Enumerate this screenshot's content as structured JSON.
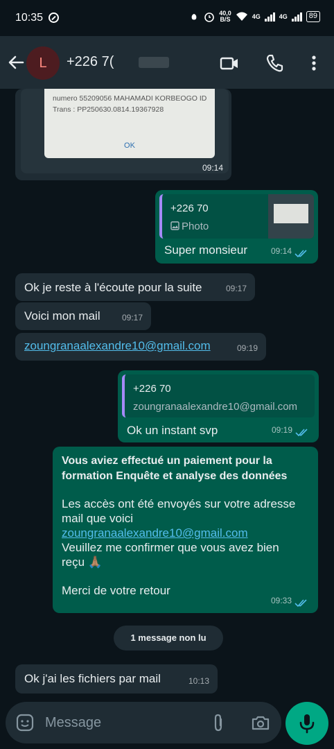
{
  "status": {
    "time": "10:35",
    "net_speed_value": "40,0",
    "net_speed_unit": "B/S",
    "net1": "4G",
    "net2": "4G",
    "battery": "89"
  },
  "header": {
    "avatar_letter": "L",
    "contact": "+226 7("
  },
  "messages": {
    "photo_in": {
      "receipt_line1": "numero 55209056 MAHAMADI KORBEOGO ID",
      "receipt_line2": "Trans : PP250630.0814.19367928",
      "receipt_ok": "OK",
      "time": "09:14"
    },
    "reply1": {
      "quote_name": "+226 70",
      "quote_sub": "Photo",
      "text": "Super monsieur",
      "time": "09:14"
    },
    "m1": {
      "text": "Ok je reste à l'écoute pour la suite",
      "time": "09:17"
    },
    "m2": {
      "text": "Voici mon mail",
      "time": "09:17"
    },
    "m3": {
      "text": "zoungranaalexandre10@gmail.com",
      "time": "09:19"
    },
    "reply2": {
      "quote_name": "+226 70",
      "quote_sub": "zoungranaalexandre10@gmail.com",
      "text": "Ok un instant svp",
      "time": "09:19"
    },
    "long": {
      "bold": "Vous aviez effectué un paiement pour la formation Enquête et analyse des données",
      "p1": "Les accès ont été envoyés sur votre adresse mail que voici",
      "link": "zoungranaalexandre10@gmail.com",
      "p2": "Veuillez me confirmer que vous avez bien reçu 🙏🏽",
      "p3": "Merci de votre retour",
      "time": "09:33"
    },
    "unread_divider": "1 message non lu",
    "last": {
      "text": "Ok j'ai les fichiers  par mail",
      "time": "10:13"
    }
  },
  "input": {
    "placeholder": "Message"
  },
  "colors": {
    "incoming": "#1f2c34",
    "outgoing": "#005c4b",
    "accent": "#00a884",
    "link": "#53bdeb",
    "read_ticks": "#53bdeb"
  }
}
